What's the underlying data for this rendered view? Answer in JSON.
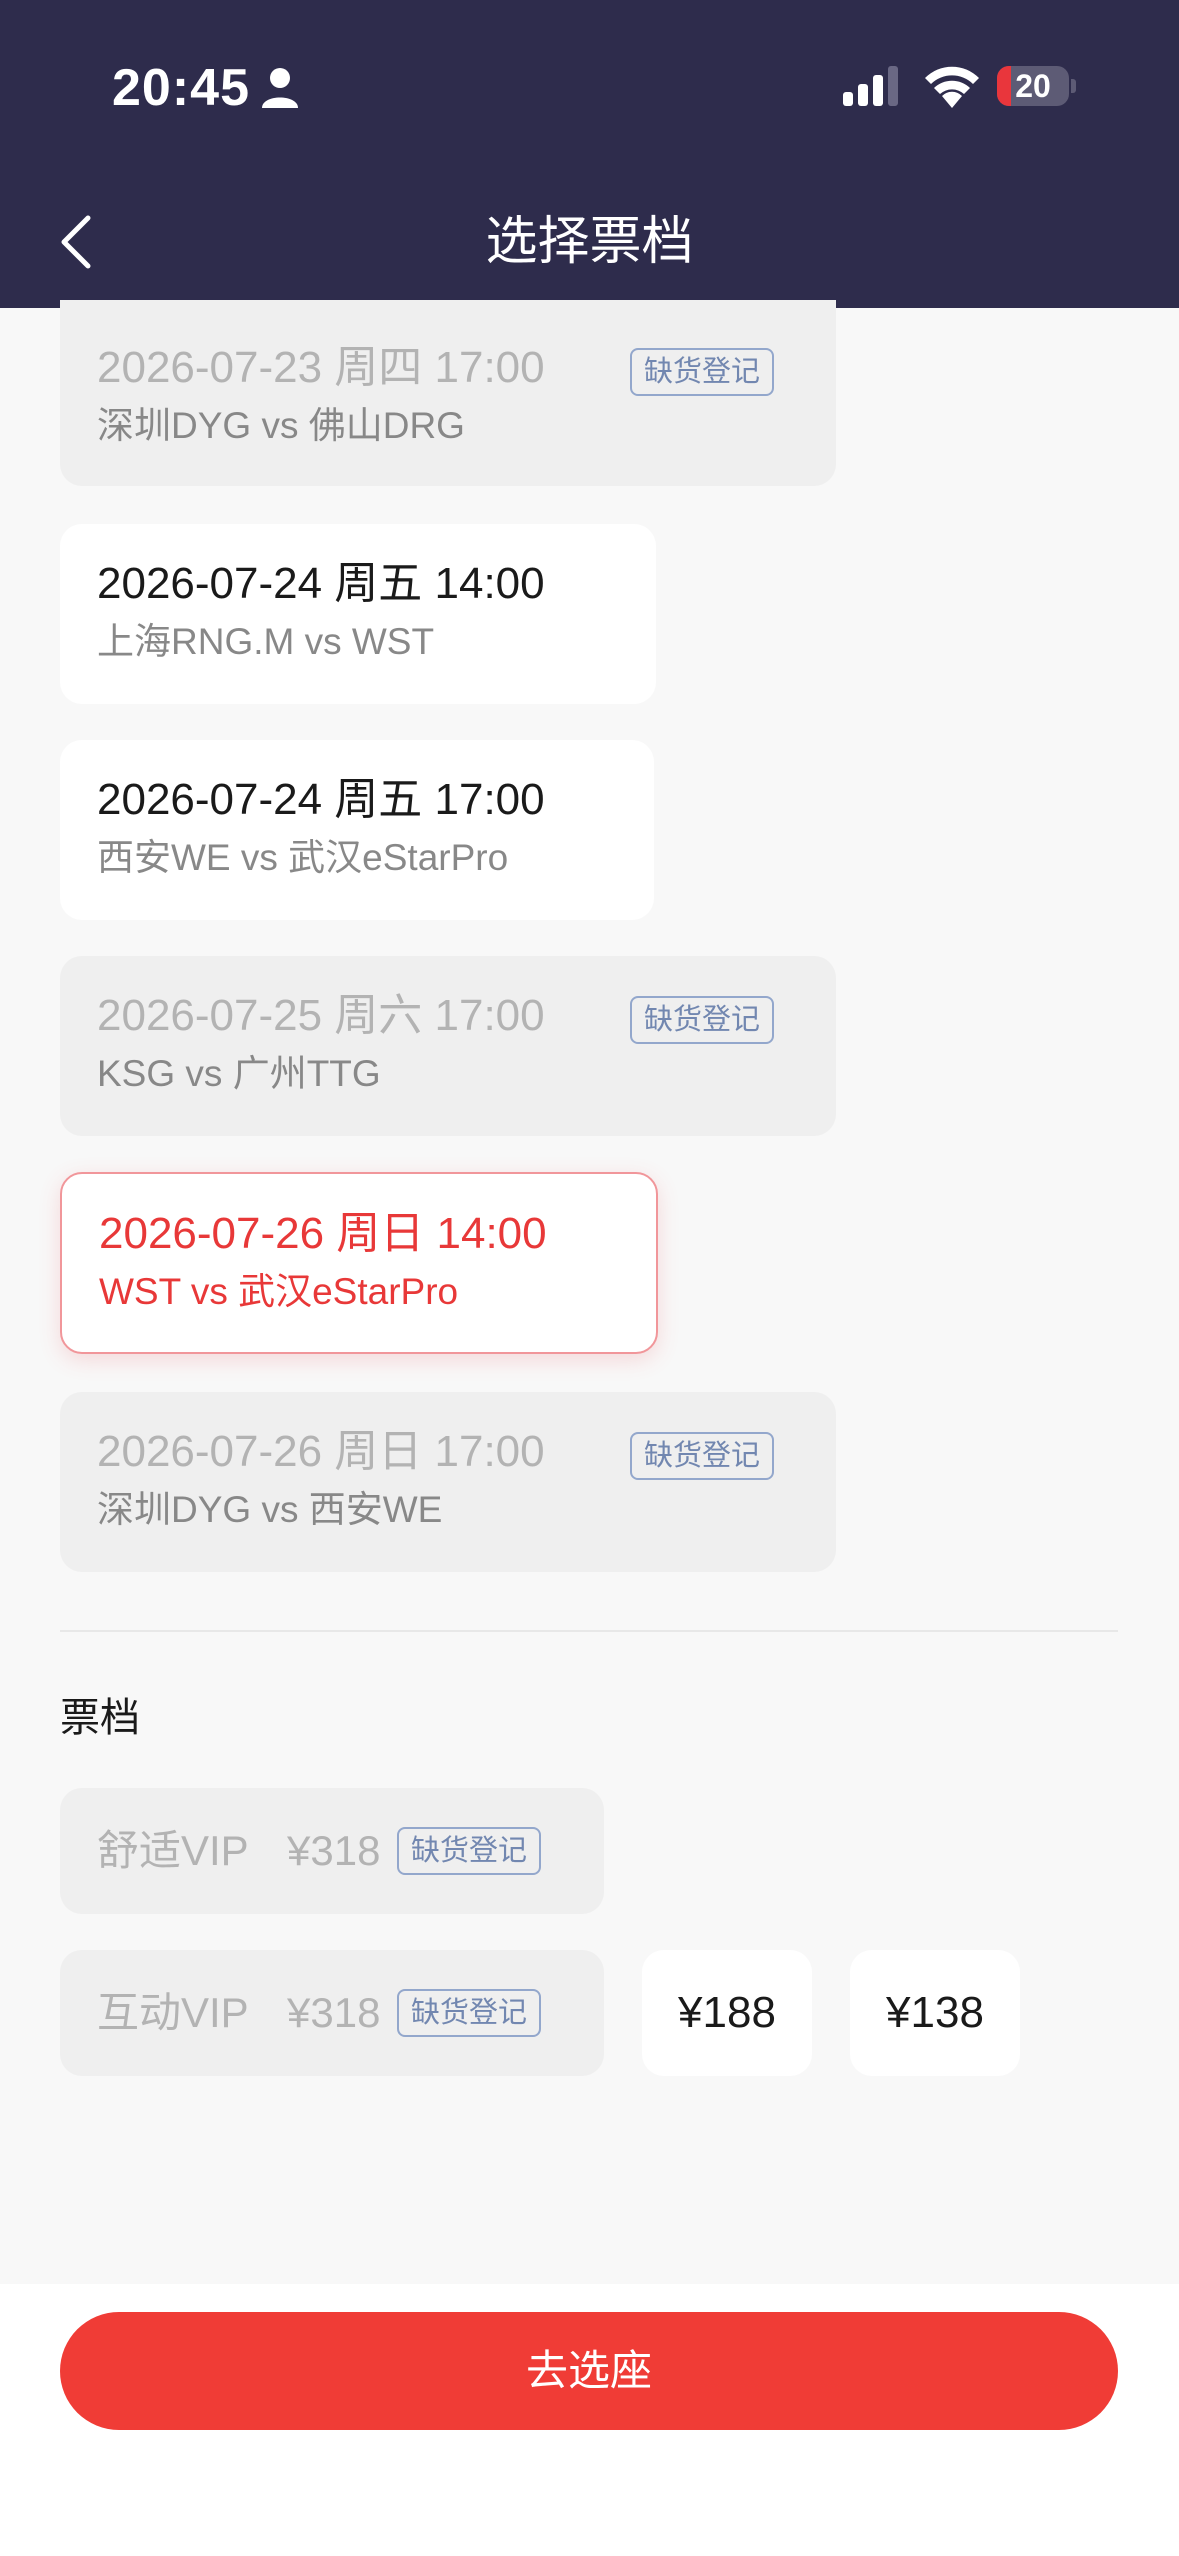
{
  "status_bar": {
    "time": "20:45",
    "battery": "20",
    "battery_level": 0.2
  },
  "header": {
    "title": "选择票档"
  },
  "sessions": [
    {
      "date": "2026-07-23 周四 17:00",
      "teams": "深圳DYG vs 佛山DRG",
      "state": "soldout",
      "badge": "缺货登记"
    },
    {
      "date": "2026-07-24 周五 14:00",
      "teams": "上海RNG.M vs WST",
      "state": "available"
    },
    {
      "date": "2026-07-24 周五 17:00",
      "teams": "西安WE vs 武汉eStarPro",
      "state": "available"
    },
    {
      "date": "2026-07-25 周六 17:00",
      "teams": "KSG vs 广州TTG",
      "state": "soldout",
      "badge": "缺货登记"
    },
    {
      "date": "2026-07-26 周日 14:00",
      "teams": "WST vs 武汉eStarPro",
      "state": "selected"
    },
    {
      "date": "2026-07-26 周日 17:00",
      "teams": "深圳DYG vs 西安WE",
      "state": "soldout",
      "badge": "缺货登记"
    }
  ],
  "tiers": {
    "heading": "票档",
    "items": [
      {
        "name": "舒适VIP",
        "price": "¥318",
        "state": "soldout",
        "badge": "缺货登记"
      },
      {
        "name": "互动VIP",
        "price": "¥318",
        "state": "soldout",
        "badge": "缺货登记"
      },
      {
        "price": "¥188",
        "state": "available"
      },
      {
        "price": "¥138",
        "state": "available"
      }
    ]
  },
  "footer": {
    "button_label": "去选座"
  },
  "colors": {
    "header_bg": "#2e2c4c",
    "accent_red": "#e83838",
    "button_red": "#f03c36",
    "badge_blue": "#7287b0",
    "soldout_bg": "#efefef"
  }
}
